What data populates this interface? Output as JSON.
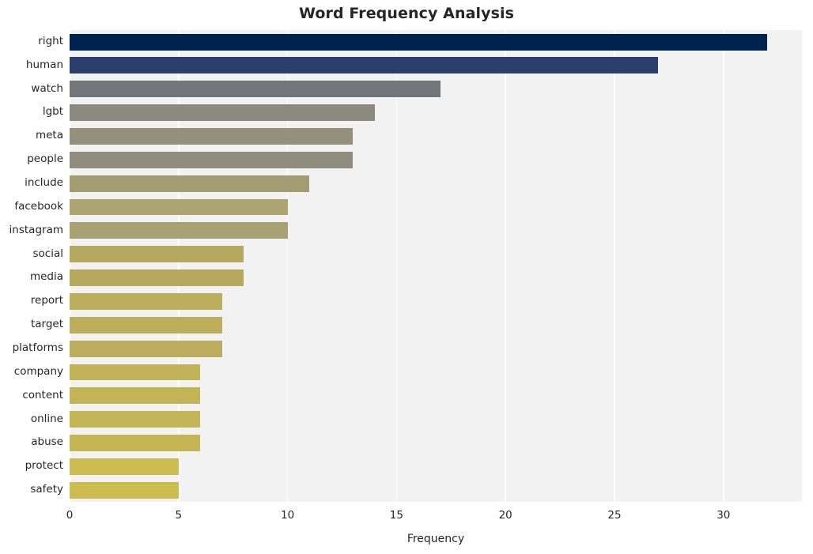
{
  "chart_data": {
    "type": "bar",
    "orientation": "horizontal",
    "title": "Word Frequency Analysis",
    "xlabel": "Frequency",
    "ylabel": "",
    "xlim": [
      0,
      33.6
    ],
    "ylim": [
      0,
      20
    ],
    "grid": true,
    "grid_axis": "x",
    "legend": null,
    "xticks": [
      0,
      5,
      10,
      15,
      20,
      25,
      30
    ],
    "xticklabels": [
      "0",
      "5",
      "10",
      "15",
      "20",
      "25",
      "30"
    ],
    "categories": [
      "right",
      "human",
      "watch",
      "lgbt",
      "meta",
      "people",
      "include",
      "facebook",
      "instagram",
      "social",
      "media",
      "report",
      "target",
      "platforms",
      "company",
      "content",
      "online",
      "abuse",
      "protect",
      "safety"
    ],
    "values": [
      32,
      27,
      17,
      14,
      13,
      13,
      11,
      10,
      10,
      8,
      8,
      7,
      7,
      7,
      6,
      6,
      6,
      6,
      5,
      5
    ],
    "bar_colors": [
      "#00224e",
      "#2b3f6c",
      "#74757b",
      "#8b8a7f",
      "#94907a",
      "#908d7e",
      "#a39c72",
      "#ada471",
      "#a9a173",
      "#b5a85f",
      "#b6a95e",
      "#bcae5c",
      "#bcae5c",
      "#bbad5d",
      "#c2b358",
      "#c3b457",
      "#c4b556",
      "#c5b555",
      "#ccbb50",
      "#cdbc4f"
    ],
    "plot_background": "#f2f2f3",
    "gridline_color": "#ffffff",
    "figure_background": "#ffffff",
    "text_color": "#262626"
  }
}
